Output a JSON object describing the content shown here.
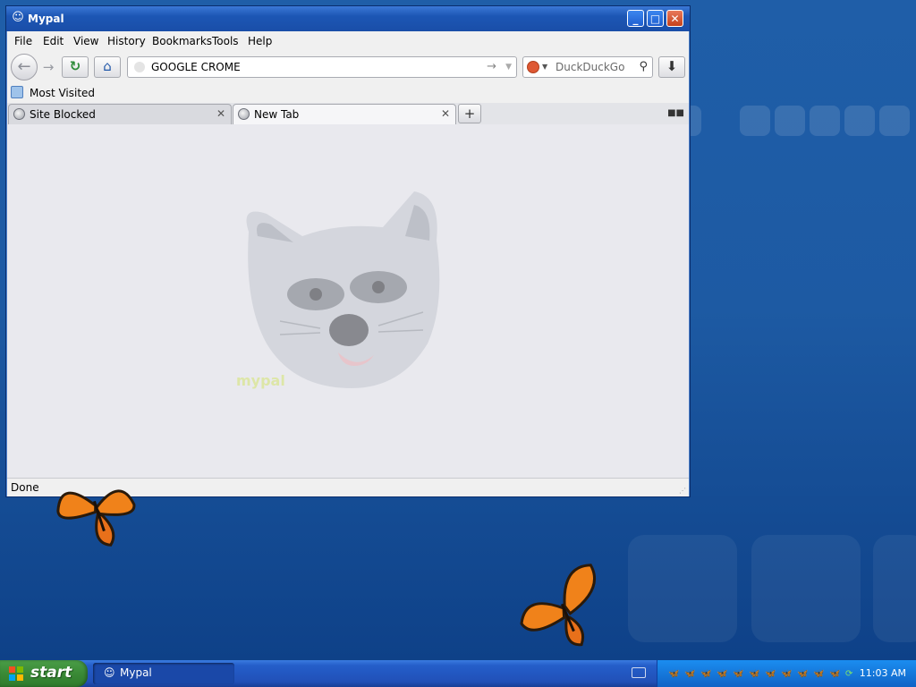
{
  "window": {
    "title": "Mypal",
    "controls": {
      "minimize": "_",
      "maximize": "□",
      "close": "✕"
    }
  },
  "menu": {
    "items": [
      "File",
      "Edit",
      "View",
      "History",
      "Bookmarks",
      "Tools",
      "Help"
    ]
  },
  "navbar": {
    "url_value": "GOOGLE CROME",
    "search_engine": "DuckDuckGo",
    "search_placeholder": "DuckDuckGo"
  },
  "bookmarks": {
    "most_visited": "Most Visited"
  },
  "tabs": [
    {
      "label": "Site Blocked",
      "active": false
    },
    {
      "label": "New Tab",
      "active": true
    }
  ],
  "status": {
    "text": "Done"
  },
  "taskbar": {
    "start_label": "start",
    "task_label": "Mypal",
    "clock": "11:03 AM"
  },
  "colors": {
    "desktop": "#1d5aa3",
    "titlebar": "#1c56b4",
    "start": "#3a8a36"
  },
  "icons": [
    "back-icon",
    "forward-icon",
    "reload-icon",
    "home-icon",
    "go-arrow-icon",
    "search-magnifier-icon",
    "download-icon",
    "globe-icon",
    "close-tab-icon",
    "new-tab-icon"
  ]
}
